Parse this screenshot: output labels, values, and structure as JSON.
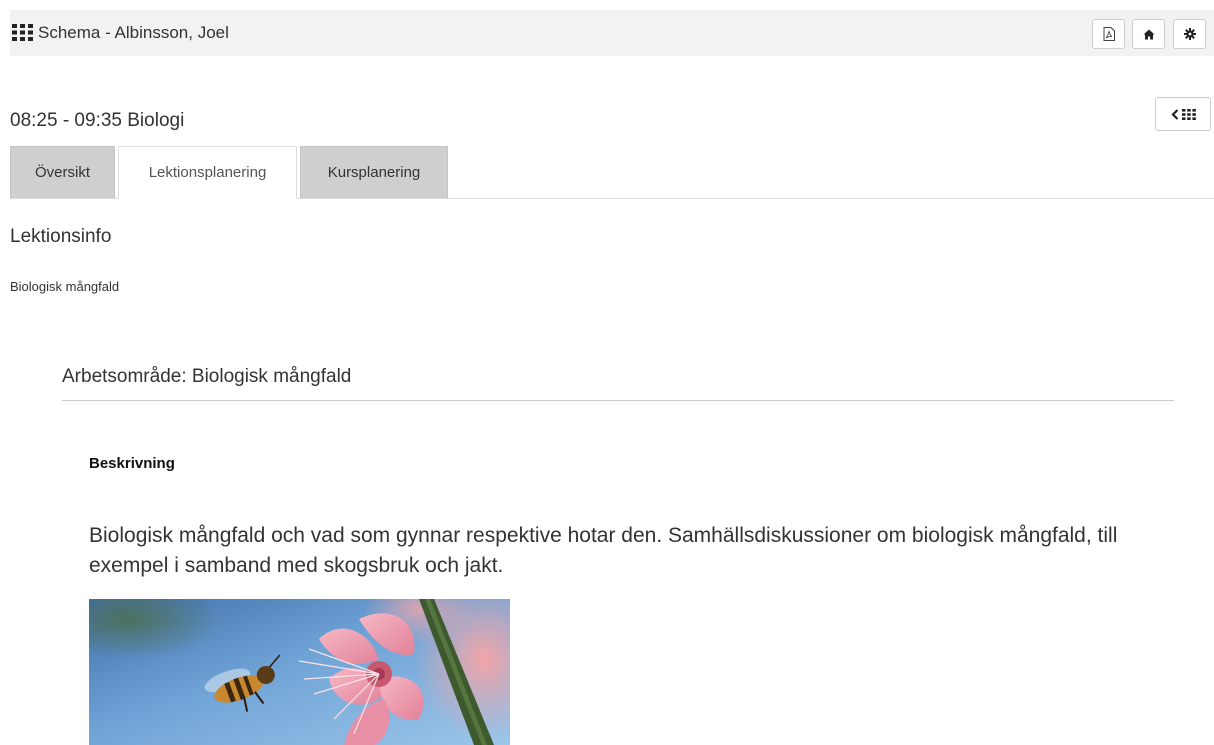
{
  "header": {
    "title": "Schema - Albinsson, Joel",
    "menu_icon": "grid-icon",
    "buttons": [
      {
        "name": "pdf-icon"
      },
      {
        "name": "home-icon"
      },
      {
        "name": "gear-icon"
      }
    ]
  },
  "lesson": {
    "title": "08:25 - 09:35 Biologi",
    "back_button_icons": [
      "chevron-left-icon",
      "grid-icon"
    ]
  },
  "tabs": [
    {
      "label": "Översikt",
      "active": false
    },
    {
      "label": "Lektionsplanering",
      "active": true
    },
    {
      "label": "Kursplanering",
      "active": false
    }
  ],
  "lesson_info": {
    "heading": "Lektionsinfo",
    "text": "Biologisk mångfald"
  },
  "work_area": {
    "title": "Arbetsområde: Biologisk mångfald",
    "description_label": "Beskrivning",
    "description": "Biologisk mångfald och vad som gynnar respektive hotar den. Samhällsdiskussioner om biologisk mångfald, till exempel i samband med skogsbruk och jakt.",
    "image": "bee-on-pink-flower-photo"
  },
  "colors": {
    "topbar_bg": "#f2f2f2",
    "inactive_tab_bg": "#cfcfcf",
    "text": "#333333"
  }
}
